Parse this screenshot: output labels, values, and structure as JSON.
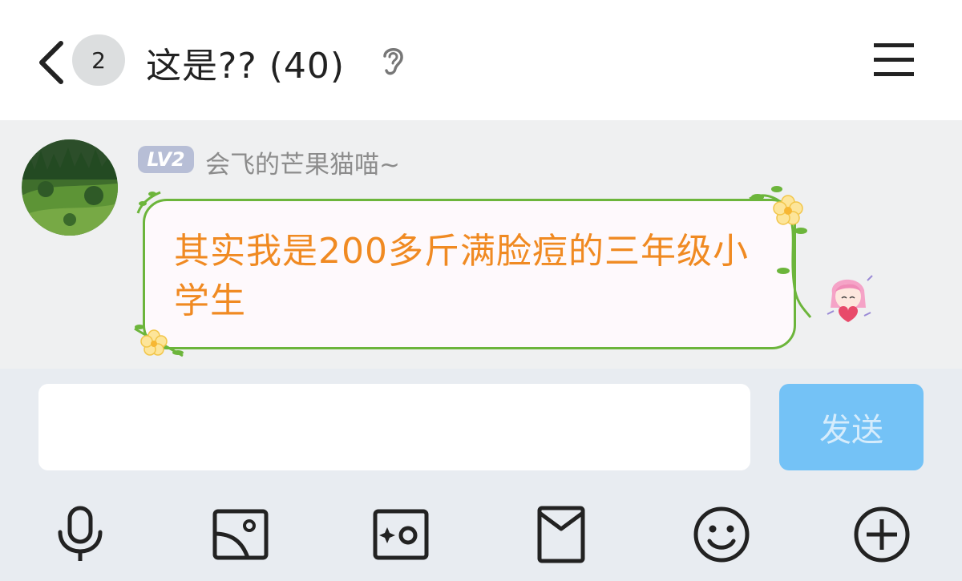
{
  "header": {
    "unread_count": "2",
    "title": "这是?? (40)"
  },
  "message": {
    "level": "LV2",
    "sender": "会飞的芒果猫喵~",
    "text": "其实我是200多斤满脸痘的三年级小学生"
  },
  "input": {
    "placeholder": "",
    "send_label": "发送"
  },
  "toolbar": {
    "icons": [
      "microphone-icon",
      "image-icon",
      "photo-effect-icon",
      "red-envelope-icon",
      "emoji-icon",
      "plus-icon"
    ]
  },
  "colors": {
    "bubble_border": "#6cb53b",
    "bubble_text": "#f08a22",
    "send_button": "#74c2f6",
    "level_badge": "#b7bed6"
  }
}
